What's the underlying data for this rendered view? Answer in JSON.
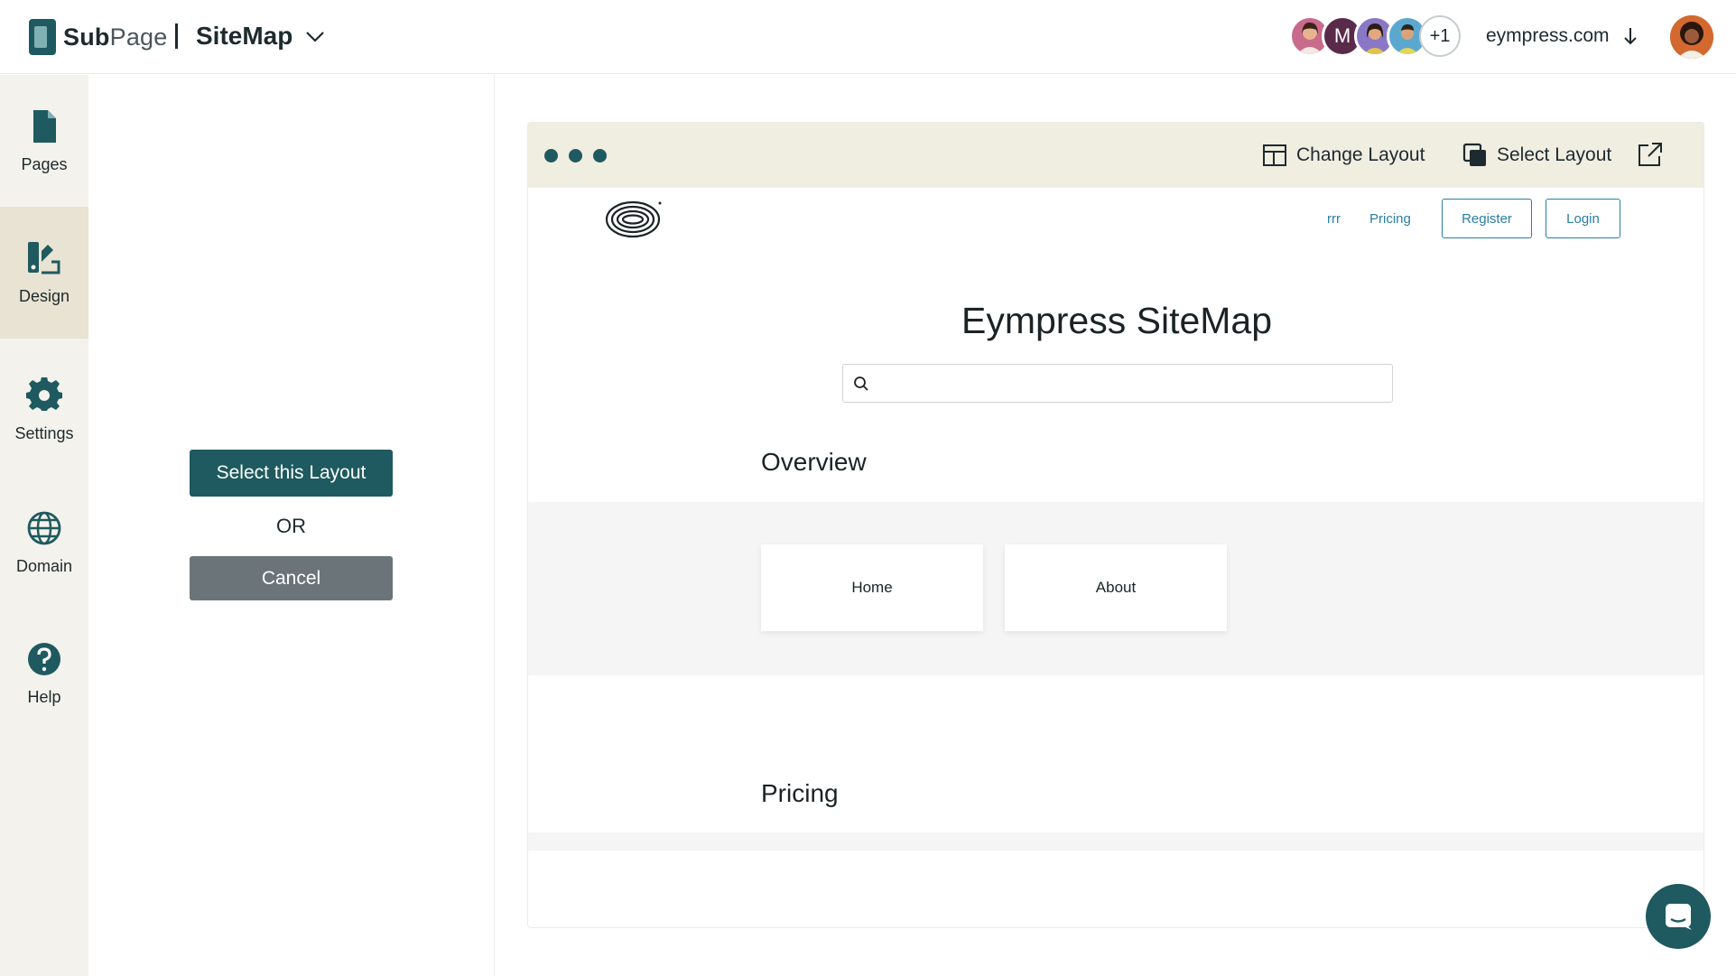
{
  "header": {
    "brand_bold": "Sub",
    "brand_light": "Page",
    "site_title": "SiteMap",
    "collaborators": [
      {
        "initial": "",
        "color": "#c96b8c"
      },
      {
        "initial": "M",
        "color": "#5a2a4a"
      },
      {
        "initial": "",
        "color": "#8a78c6"
      },
      {
        "initial": "",
        "color": "#5aa8cf"
      }
    ],
    "collaborators_more": "+1",
    "domain": "eympress.com"
  },
  "sidebar": {
    "items": [
      {
        "label": "Pages",
        "icon": "page-icon"
      },
      {
        "label": "Design",
        "icon": "design-icon"
      },
      {
        "label": "Settings",
        "icon": "gear-icon"
      },
      {
        "label": "Domain",
        "icon": "globe-icon"
      },
      {
        "label": "Help",
        "icon": "help-icon"
      }
    ],
    "active": "Design"
  },
  "panel": {
    "select_label": "Select this Layout",
    "or_label": "OR",
    "cancel_label": "Cancel"
  },
  "preview": {
    "change_layout_label": "Change Layout",
    "select_layout_label": "Select Layout",
    "site": {
      "nav_links": [
        "rrr",
        "Pricing"
      ],
      "register_label": "Register",
      "login_label": "Login",
      "heading": "Eympress SiteMap",
      "sections": [
        {
          "title": "Overview",
          "cards": [
            "Home",
            "About"
          ]
        },
        {
          "title": "Pricing",
          "cards": []
        }
      ]
    }
  },
  "colors": {
    "accent": "#1e5a5f",
    "link": "#2a7ea3",
    "sidebar_bg": "#f4f2ec",
    "preview_bar": "#f0ede1"
  }
}
